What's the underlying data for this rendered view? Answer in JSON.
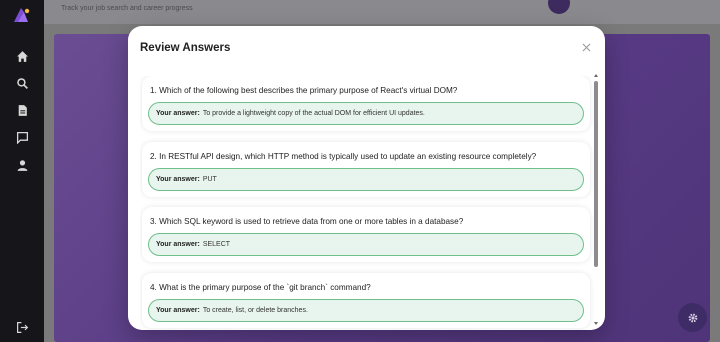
{
  "app": {
    "subtitle": "Track your job search and career progress",
    "sidebar_icons": [
      "home-icon",
      "search-icon",
      "document-icon",
      "chat-icon",
      "user-icon",
      "logout-icon"
    ],
    "settings_icon": "gear-icon"
  },
  "modal": {
    "title": "Review Answers",
    "close_icon": "close-icon",
    "answer_label": "Your answer:",
    "questions": [
      {
        "question": "1. Which of the following best describes the primary purpose of React's virtual DOM?",
        "answer": "To provide a lightweight copy of the actual DOM for efficient UI updates."
      },
      {
        "question": "2. In RESTful API design, which HTTP method is typically used to update an existing resource completely?",
        "answer": "PUT"
      },
      {
        "question": "3. Which SQL keyword is used to retrieve data from one or more tables in a database?",
        "answer": "SELECT"
      },
      {
        "question": "4. What is the primary purpose of the `git branch` command?",
        "answer": "To create, list, or delete branches."
      }
    ]
  },
  "colors": {
    "accent": "#6a4d92",
    "answer_bg": "#e8f5ee",
    "answer_border": "#6fbf8d"
  }
}
